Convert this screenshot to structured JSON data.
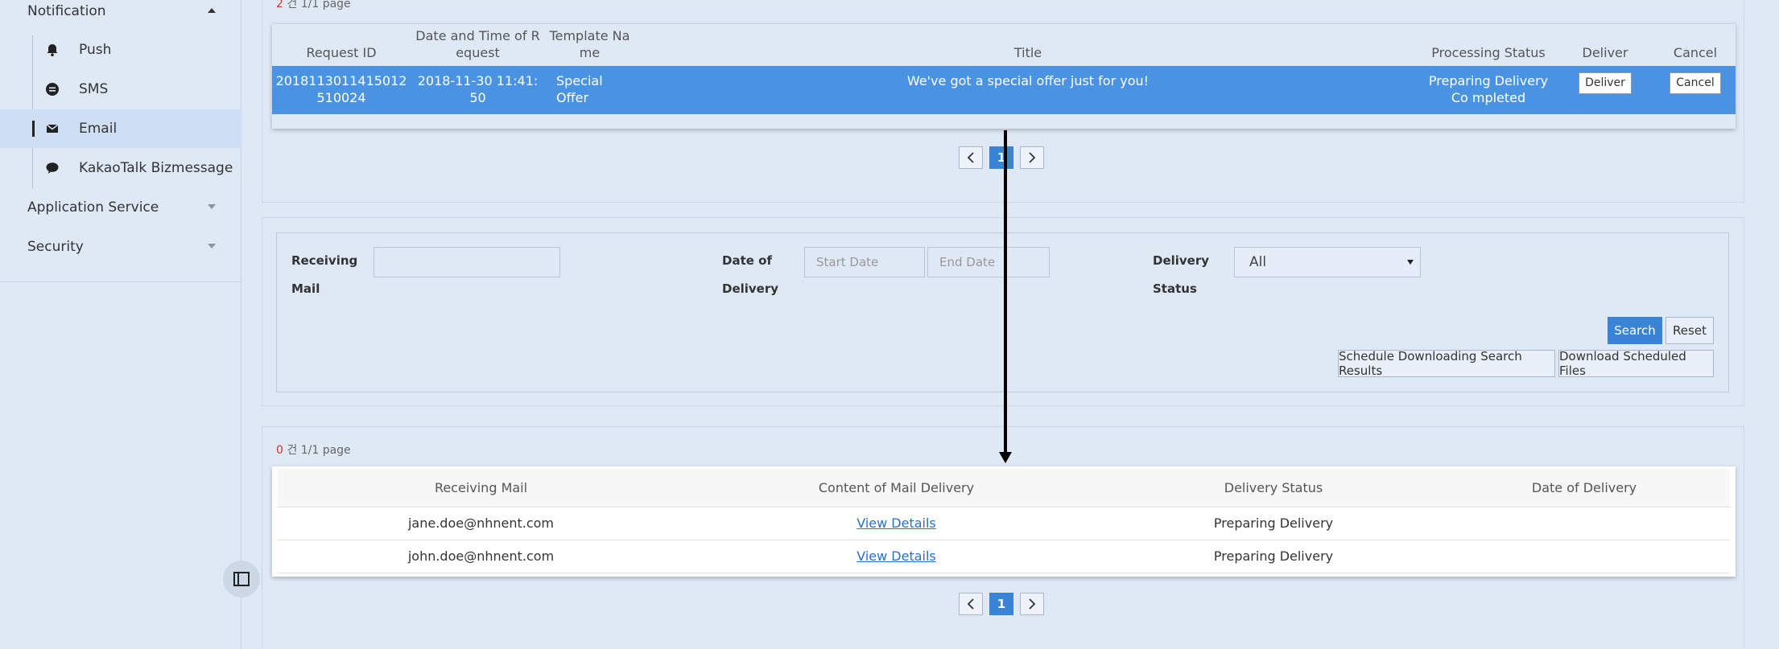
{
  "sidebar": {
    "notification": "Notification",
    "items": [
      {
        "label": "Push",
        "icon": "bell-icon"
      },
      {
        "label": "SMS",
        "icon": "sms-icon"
      },
      {
        "label": "Email",
        "icon": "envelope-icon"
      },
      {
        "label": "KakaoTalk Bizmessage",
        "icon": "speech-bubble-icon"
      }
    ],
    "application_service": "Application Service",
    "security": "Security"
  },
  "request_list": {
    "count_num": "2",
    "count_suffix": "건",
    "page_info": "1/1 page",
    "headers": {
      "request_id": "Request ID",
      "date_time": "Date and Time of R equest",
      "template": "Template Na me",
      "title": "Title",
      "status": "Processing Status",
      "deliver": "Deliver",
      "cancel": "Cancel"
    },
    "row": {
      "request_id": "2018113011415012 510024",
      "date_time": "2018-11-30 11:41: 50",
      "template": "Special Offer",
      "title": "We've got a special offer just for you!",
      "status": "Preparing Delivery Co mpleted",
      "deliver_btn": "Deliver",
      "cancel_btn": "Cancel"
    },
    "page": "1"
  },
  "search_form": {
    "receiving_mail_label": "Receiving Mail",
    "date_label": "Date of Delivery",
    "start_placeholder": "Start Date",
    "end_placeholder": "End Date",
    "status_label": "Delivery Status",
    "status_selected": "All",
    "search_btn": "Search",
    "reset_btn": "Reset",
    "schedule_btn": "Schedule Downloading Search Results",
    "download_btn": "Download Scheduled Files"
  },
  "delivery_list": {
    "count_num": "0",
    "count_suffix": "건",
    "page_info": "1/1 page",
    "headers": [
      "Receiving Mail",
      "Content of Mail Delivery",
      "Delivery Status",
      "Date of Delivery"
    ],
    "rows": [
      {
        "mail": "jane.doe@nhnent.com",
        "content": "View Details",
        "status": "Preparing Delivery",
        "date": ""
      },
      {
        "mail": "john.doe@nhnent.com",
        "content": "View Details",
        "status": "Preparing Delivery",
        "date": ""
      }
    ],
    "page": "1"
  },
  "colors": {
    "accent": "#3a84d6",
    "selected_row": "#4a93e3",
    "count_num": "#c0392b"
  }
}
